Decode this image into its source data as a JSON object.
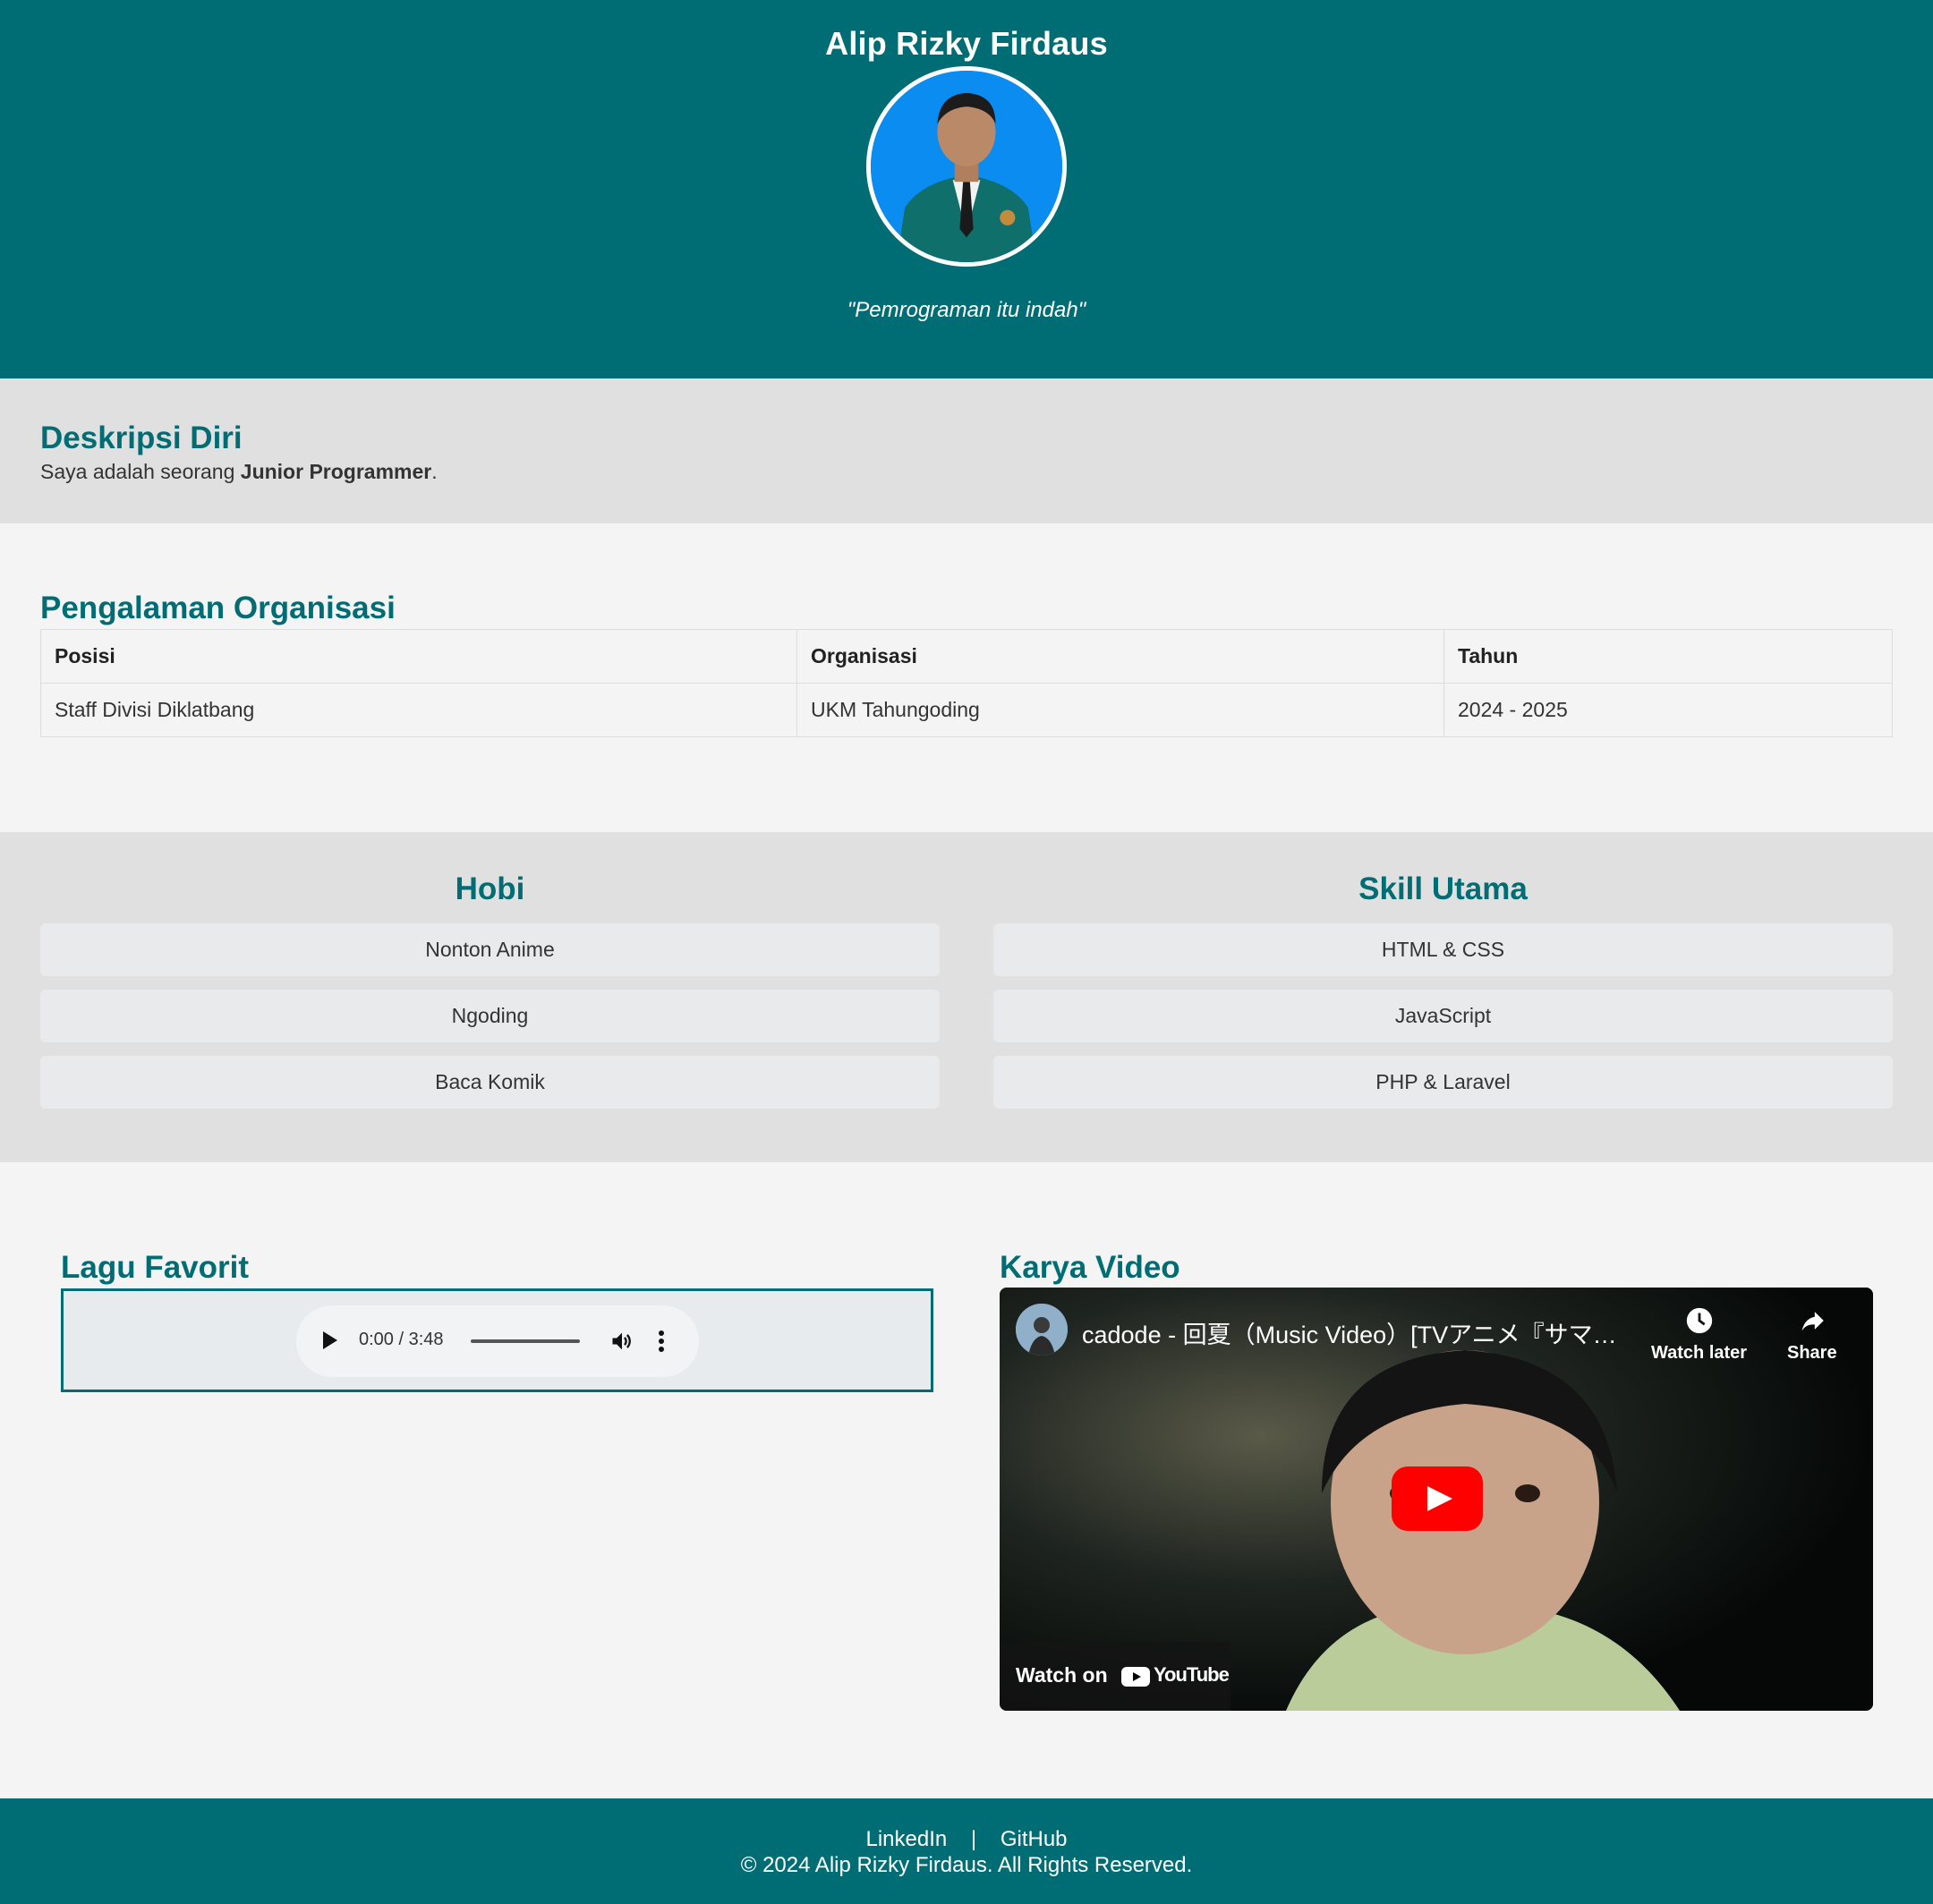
{
  "header": {
    "name": "Alip Rizky Firdaus",
    "quote": "\"Pemrograman itu indah\""
  },
  "about": {
    "title": "Deskripsi Diri",
    "text_prefix": "Saya adalah seorang ",
    "text_bold": "Junior Programmer",
    "text_suffix": "."
  },
  "organization": {
    "title": "Pengalaman Organisasi",
    "columns": [
      "Posisi",
      "Organisasi",
      "Tahun"
    ],
    "rows": [
      [
        "Staff Divisi Diklatbang",
        "UKM Tahungoding",
        "2024 - 2025"
      ]
    ]
  },
  "hobbies": {
    "title": "Hobi",
    "items": [
      "Nonton Anime",
      "Ngoding",
      "Baca Komik"
    ]
  },
  "skills": {
    "title": "Skill Utama",
    "items": [
      "HTML & CSS",
      "JavaScript",
      "PHP & Laravel"
    ]
  },
  "music": {
    "title": "Lagu Favorit",
    "time": "0:00 / 3:48"
  },
  "video": {
    "title": "Karya Video",
    "video_title": "cadode - 回夏（Music Video）[TVアニメ『サマー…",
    "watch_later": "Watch later",
    "share": "Share",
    "watch_on": "Watch on",
    "youtube": "YouTube"
  },
  "footer": {
    "linkedin": "LinkedIn",
    "separator": "|",
    "github": "GitHub",
    "copyright": "© 2024 Alip Rizky Firdaus. All Rights Reserved."
  },
  "colors": {
    "primary": "#006d75",
    "section_gray": "#e0e0e0",
    "background": "#f4f4f4",
    "youtube_red": "#ff0000"
  }
}
